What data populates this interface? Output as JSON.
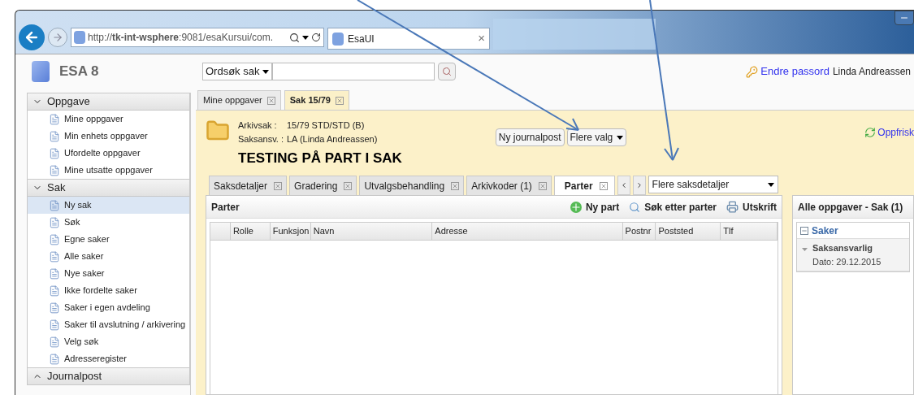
{
  "browser": {
    "address": "http://**tk-int-wsphere**:9081/esaKursui/com.",
    "tab": {
      "title": "EsaUI",
      "close": "×"
    }
  },
  "app": {
    "logo": "ESA 8",
    "search": {
      "scope": "Ordsøk sak"
    },
    "user": {
      "link": "Endre passord",
      "name": "Linda Andreassen"
    }
  },
  "sidebar": {
    "sections": [
      {
        "title": "Oppgave",
        "expanded": true,
        "items": [
          {
            "label": "Mine oppgaver",
            "selected": false
          },
          {
            "label": "Min enhets oppgaver",
            "selected": false
          },
          {
            "label": "Ufordelte oppgaver",
            "selected": false
          },
          {
            "label": "Mine utsatte oppgaver",
            "selected": false
          }
        ]
      },
      {
        "title": "Sak",
        "expanded": true,
        "items": [
          {
            "label": "Ny sak",
            "selected": true
          },
          {
            "label": "Søk",
            "selected": false
          },
          {
            "label": "Egne saker",
            "selected": false
          },
          {
            "label": "Alle saker",
            "selected": false
          },
          {
            "label": "Nye saker",
            "selected": false
          },
          {
            "label": "Ikke fordelte saker",
            "selected": false
          },
          {
            "label": "Saker i egen avdeling",
            "selected": false
          },
          {
            "label": "Saker til avslutning / arkivering",
            "selected": false
          },
          {
            "label": "Velg søk",
            "selected": false
          },
          {
            "label": "Adresseregister",
            "selected": false
          }
        ]
      },
      {
        "title": "Journalpost",
        "expanded": false
      }
    ]
  },
  "tabs": [
    {
      "label": "Mine oppgaver",
      "selected": false
    },
    {
      "label": "Sak 15/79",
      "selected": true
    }
  ],
  "case": {
    "fields": [
      {
        "label": "Arkivsak :",
        "value": "15/79 STD/STD (B)"
      },
      {
        "label": "Saksansv. :",
        "value": "LA (Linda Andreassen)"
      }
    ],
    "title": "TESTING PÅ PART I SAK",
    "buttons": [
      {
        "label": "Ny journalpost",
        "kind": "button"
      },
      {
        "label": "Flere valg",
        "kind": "dropdown"
      }
    ],
    "refresh": "Oppfrisk"
  },
  "detail_tabs": [
    {
      "label": "Saksdetaljer",
      "selected": false
    },
    {
      "label": "Gradering",
      "selected": false
    },
    {
      "label": "Utvalgsbehandling",
      "selected": false
    },
    {
      "label": "Arkivkoder (1)",
      "selected": false
    },
    {
      "label": "Parter",
      "selected": true
    }
  ],
  "more_details": "Flere saksdetaljer",
  "parter": {
    "title": "Parter",
    "actions": [
      {
        "label": "Ny part",
        "kind": "add"
      },
      {
        "label": "Søk etter parter",
        "kind": "search"
      },
      {
        "label": "Utskrift",
        "kind": "print"
      }
    ],
    "columns": [
      "Rolle",
      "Funksjon",
      "Navn",
      "Adresse",
      "Postnr",
      "Poststed",
      "Tlf"
    ]
  },
  "tasks_panel": {
    "title": "Alle oppgaver - Sak (1)",
    "group": {
      "title": "Saker",
      "expanded": true
    },
    "items": [
      {
        "title": "Saksansvarlig",
        "date": "Dato: 29.12.2015"
      }
    ]
  }
}
